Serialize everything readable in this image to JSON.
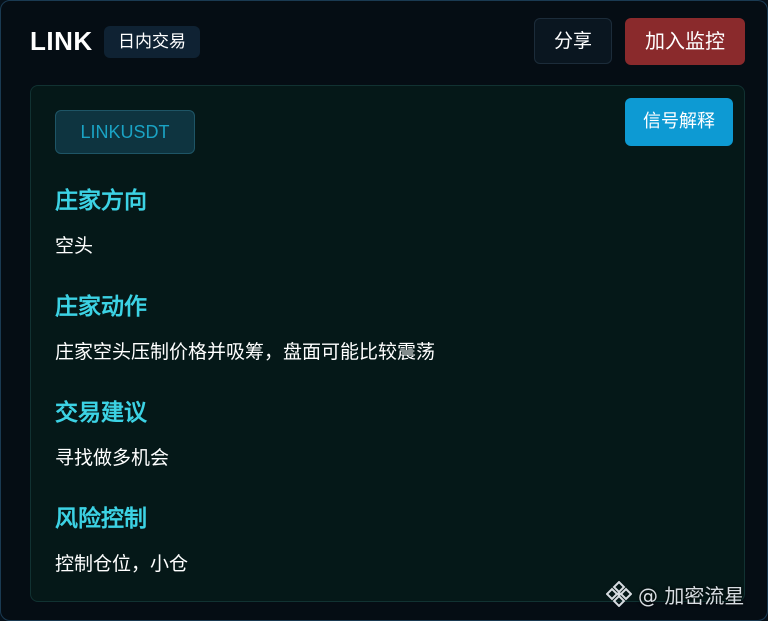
{
  "header": {
    "symbol": "LINK",
    "mode": "日内交易",
    "share_label": "分享",
    "monitor_label": "加入监控"
  },
  "card": {
    "ticker": "LINKUSDT",
    "explain_label": "信号解释",
    "sections": [
      {
        "title": "庄家方向",
        "text": "空头"
      },
      {
        "title": "庄家动作",
        "text": "庄家空头压制价格并吸筹，盘面可能比较震荡"
      },
      {
        "title": "交易建议",
        "text": "寻找做多机会"
      },
      {
        "title": "风险控制",
        "text": "控制仓位，小仓"
      }
    ]
  },
  "watermark": {
    "icon": "binance-icon",
    "text": "@ 加密流星"
  },
  "colors": {
    "background": "#061019",
    "card": "#051818",
    "section_title": "#3cd2e4",
    "monitor_button": "#8a2a2c",
    "explain_button": "#0d9ad3",
    "ticker_text": "#1aa3c4"
  }
}
